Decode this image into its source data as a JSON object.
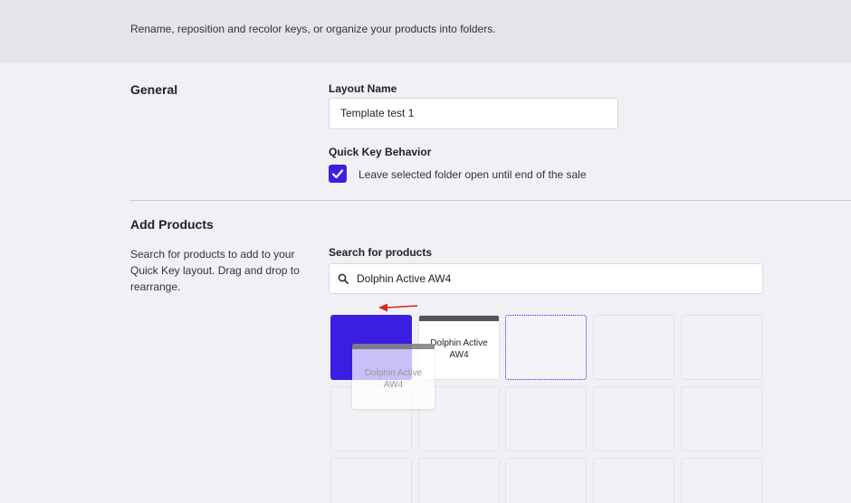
{
  "header": {
    "description": "Rename, reposition and recolor keys, or organize your products into folders."
  },
  "general": {
    "title": "General",
    "layout_name_label": "Layout Name",
    "layout_name_value": "Template test 1",
    "quick_key_label": "Quick Key Behavior",
    "checkbox_checked": true,
    "checkbox_label": "Leave selected folder open until end of the sale"
  },
  "add_products": {
    "title": "Add Products",
    "help_text": "Search for products to add to your Quick Key layout. Drag and drop to rearrange.",
    "search_label": "Search for products",
    "search_value": "Dolphin Active AW4"
  },
  "grid": {
    "product_key_label": "Dolphin Active AW4",
    "dragging_label": "Dolphin Active AW4",
    "accent_color": "#3b1fe0",
    "arrow_color": "#e02020"
  }
}
